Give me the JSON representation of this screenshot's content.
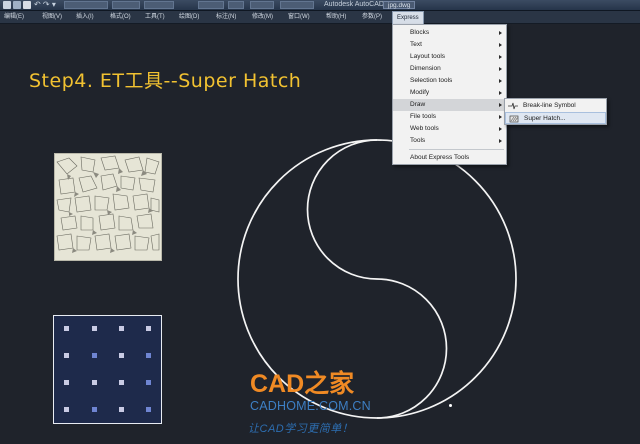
{
  "window": {
    "title": "Autodesk AutoCAD 2013",
    "file_tab": "jpg.dwg"
  },
  "menubar": {
    "items": [
      "编辑(E)",
      "视图(V)",
      "插入(I)",
      "格式(O)",
      "工具(T)",
      "绘图(D)",
      "标注(N)",
      "修改(M)",
      "窗口(W)",
      "帮助(H)",
      "参数(P)",
      "Express"
    ]
  },
  "heading": {
    "text": "Step4. ET工具--Super Hatch"
  },
  "express_menu": {
    "items": [
      {
        "label": "Blocks",
        "submenu": true
      },
      {
        "label": "Text",
        "submenu": true
      },
      {
        "label": "Layout tools",
        "submenu": true
      },
      {
        "label": "Dimension",
        "submenu": true
      },
      {
        "label": "Selection tools",
        "submenu": true
      },
      {
        "label": "Modify",
        "submenu": true
      },
      {
        "label": "Draw",
        "submenu": true,
        "highlighted": true
      },
      {
        "label": "File tools",
        "submenu": true
      },
      {
        "label": "Web tools",
        "submenu": true
      },
      {
        "label": "Tools",
        "submenu": true
      },
      {
        "label": "About Express Tools",
        "submenu": false
      }
    ]
  },
  "draw_submenu": {
    "items": [
      {
        "label": "Break-line Symbol",
        "icon": "break-line-icon",
        "highlighted": false
      },
      {
        "label": "Super Hatch...",
        "icon": "super-hatch-icon",
        "highlighted": true
      }
    ]
  },
  "watermark": {
    "logo": "CAD之家",
    "url": "CADHOME.COM.CN",
    "slogan": "让CAD学习更简单！"
  },
  "colors": {
    "canvas_background": "#1f232b",
    "heading": "#f2c231",
    "menu_background": "#f2f2f2",
    "menu_highlight": "#d3d5d8",
    "watermark_orange": "#f08a24",
    "watermark_blue": "#3d7fc4"
  }
}
